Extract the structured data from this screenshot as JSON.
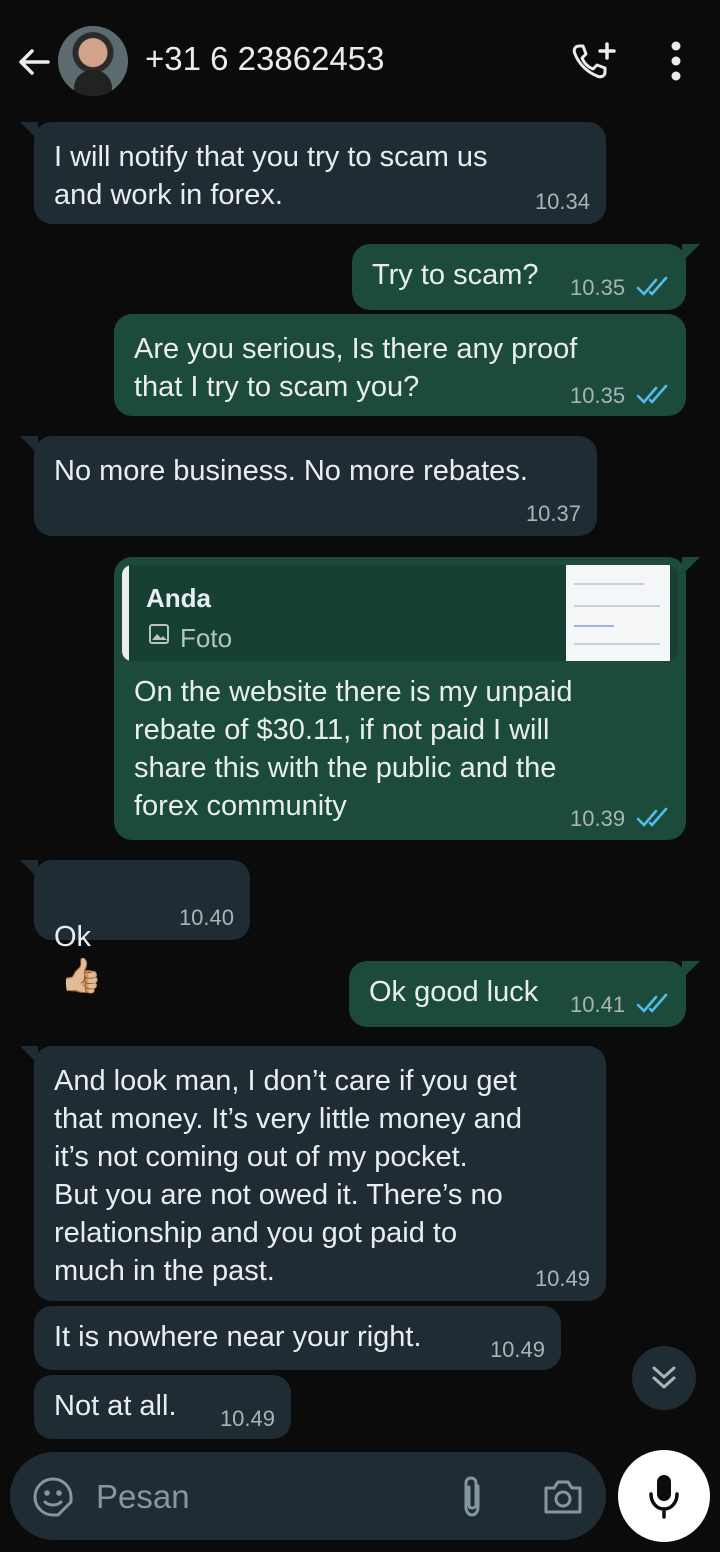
{
  "header": {
    "contact": "+31 6 23862453",
    "icons": [
      "back-arrow-icon",
      "avatar",
      "add-call-icon",
      "more-vert-icon"
    ]
  },
  "messages": [
    {
      "dir": "in",
      "text": "I will notify that you try to scam us\nand work in forex.",
      "time": "10.34"
    },
    {
      "dir": "out",
      "text": "Try to scam?",
      "time": "10.35",
      "status": "read"
    },
    {
      "dir": "out",
      "text": "Are you serious, Is there any proof\nthat I try to scam you?",
      "time": "10.35",
      "status": "read"
    },
    {
      "dir": "in",
      "text": "No more business. No more rebates.",
      "time": "10.37"
    },
    {
      "dir": "out",
      "quote_author": "Anda",
      "quote_type": "Foto",
      "text": "On the website there is my unpaid\nrebate of $30.11, if not paid I will\nshare this with the public and the\nforex community",
      "time": "10.39",
      "status": "read"
    },
    {
      "dir": "in",
      "text": "Ok",
      "emoji": "👍🏼",
      "time": "10.40"
    },
    {
      "dir": "out",
      "text": "Ok good luck",
      "time": "10.41",
      "status": "read"
    },
    {
      "dir": "in",
      "text": "And look man, I don’t care if you get\nthat money. It’s very little money and\nit’s not coming out of my pocket.\nBut you are not owed it. There’s no\nrelationship and you got paid to\nmuch in the past.",
      "time": "10.49"
    },
    {
      "dir": "in",
      "text": "It is nowhere near your right.",
      "time": "10.49"
    },
    {
      "dir": "in",
      "text": "Not at all.",
      "time": "10.49"
    }
  ],
  "composer": {
    "placeholder": "Pesan",
    "icons": [
      "sticker-icon",
      "attach-icon",
      "camera-icon",
      "mic-icon",
      "scroll-down-icon"
    ]
  },
  "colors": {
    "background": "#0b0b0b",
    "incoming_bubble": "#202c33",
    "outgoing_bubble": "#1c4a3b",
    "read_ticks": "#53bdeb"
  }
}
